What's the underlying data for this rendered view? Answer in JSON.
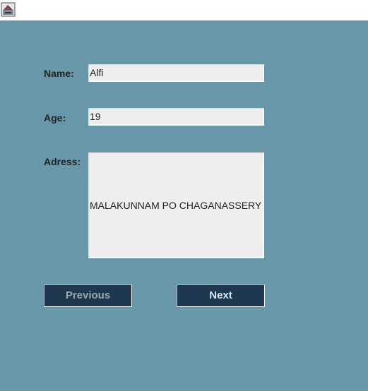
{
  "window": {
    "icon": "java-app-icon"
  },
  "form": {
    "name_label": "Name:",
    "name_value": "Alfi",
    "age_label": "Age:",
    "age_value": "19",
    "address_label": "Adress:",
    "address_value": "MALAKUNNAM PO CHAGANASSERY"
  },
  "buttons": {
    "previous_label": "Previous",
    "next_label": "Next"
  },
  "colors": {
    "panel_background": "#6897a9",
    "button_background": "#1e3850",
    "field_background": "#eeeeee"
  }
}
